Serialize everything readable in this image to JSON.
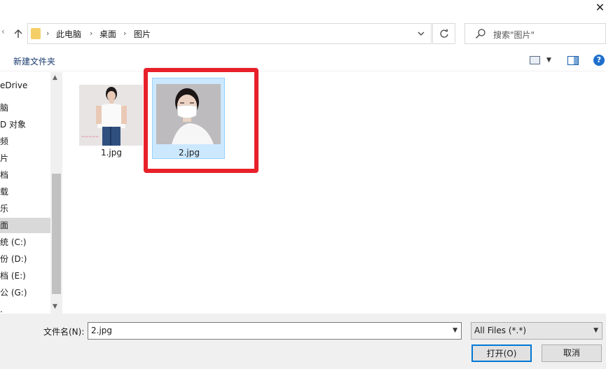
{
  "window": {
    "close_glyph": "✕"
  },
  "address": {
    "crumbs": [
      "此电脑",
      "桌面",
      "图片"
    ],
    "separator": "›"
  },
  "search": {
    "placeholder": "搜索\"图片\""
  },
  "toolbar": {
    "new_folder": "新建文件夹",
    "help_glyph": "?"
  },
  "nav": {
    "items": [
      {
        "label": "eDrive"
      },
      {
        "label": "脑"
      },
      {
        "label": "D 对象"
      },
      {
        "label": "频"
      },
      {
        "label": "片"
      },
      {
        "label": "档"
      },
      {
        "label": "载"
      },
      {
        "label": "乐"
      },
      {
        "label": "面"
      },
      {
        "label": "统 (C:)"
      },
      {
        "label": "份 (D:)"
      },
      {
        "label": "档 (E:)"
      },
      {
        "label": "公 (G:)"
      },
      {
        "label": "."
      }
    ],
    "selected_index": 8
  },
  "files": [
    {
      "name": "1.jpg",
      "icon": "photo-woman-white-shirt"
    },
    {
      "name": "2.jpg",
      "icon": "photo-woman-face-mask",
      "selected": true
    }
  ],
  "bottom": {
    "filename_label": "文件名(N):",
    "filename_value": "2.jpg",
    "filetype_value": "All Files (*.*)",
    "open_label": "打开(O)",
    "cancel_label": "取消"
  },
  "colors": {
    "highlight": "#e8202a",
    "selection": "#cce8ff",
    "accent": "#0078d7"
  }
}
